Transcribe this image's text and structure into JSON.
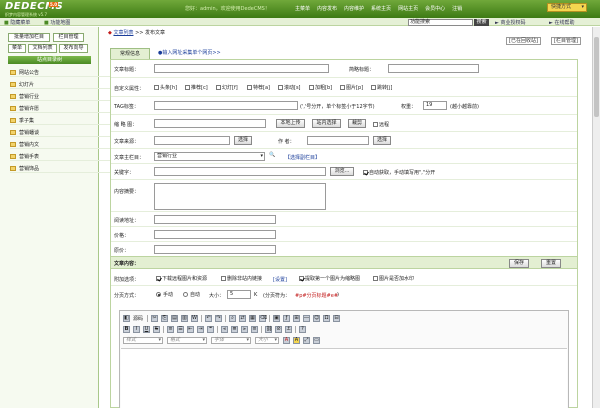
{
  "header": {
    "logo_text": "DEDECMS",
    "logo_sub": "织梦内容管理系统 v5.7",
    "logo_ver": "5.0",
    "user_info": "您好：admin，欢迎使用DedeCMS！",
    "nav": [
      "主菜单",
      "内容发布",
      "内容维护",
      "系统主页",
      "网站主页",
      "会员中心",
      "注销"
    ],
    "quick_label": "快捷方式",
    "sub": {
      "hide_menu": "隐藏菜单",
      "func_map": "功能地图",
      "search_value": "功能搜索",
      "search_button": "搜索",
      "biz_code": "商业授权码",
      "online_help": "在线帮助"
    }
  },
  "left": {
    "buttons": [
      "批量增加栏目",
      "栏目管理",
      "菜单",
      "文档列表",
      "发布向导"
    ],
    "title": "站点目录树",
    "tree": [
      "网站公告",
      "幻灯片",
      "营销行业",
      "营销许愿",
      "季子集",
      "营销蟠谈",
      "营销内文",
      "营销手表",
      "营销饰品"
    ]
  },
  "main": {
    "breadcrumb": {
      "link": "文章列表",
      "sep": ">>",
      "current": "发布文章"
    },
    "toplinks": {
      "recycle": "[已在回收站]",
      "column": "[栏目管理]"
    },
    "tabs": {
      "basic": "常规信息",
      "collect": "●输入网址采集单个网页>>"
    },
    "fields": {
      "title_label": "文章标题：",
      "short_title_label": "简略标题：",
      "custom_attr_label": "自定义属性：",
      "attrs": [
        "头条[h]",
        "推荐[c]",
        "幻灯[f]",
        "特荐[a]",
        "滚动[s]",
        "加粗[b]",
        "图片[p]",
        "跳转[j]"
      ],
      "tag_label": "TAG标签：",
      "tag_note": "(','号分开，单个标签小于12字节)",
      "weight_label": "权重：",
      "weight_value": "19",
      "weight_note": "(越小越靠前)",
      "thumb_label": "缩 略 图：",
      "btn_local": "本地上传",
      "btn_site": "站内选择",
      "btn_crop": "裁剪",
      "remote_label": "远程",
      "source_label": "文章来源：",
      "btn_select": "选择",
      "author_label": "作 者：",
      "column_label": "文章主栏目：",
      "column_value": "营销行业",
      "column_link": "【选择副栏目】",
      "keyword_label": "关键字：",
      "btn_browse": "浏览...",
      "auto_keyword": "自动获取，手动填写用\",\"分开",
      "summary_label": "内容摘要：",
      "wo_label": "阅读地址：",
      "price_label": "价格：",
      "original_price_label": "原价："
    },
    "body_bar": {
      "label": "文章内容：",
      "btn_keep": "保存",
      "btn_reset": "重置"
    },
    "options": {
      "extra_label": "附加选项：",
      "opt1": "下载远程图片和资源",
      "opt2": "删除非站内链接",
      "opt2_link": "[设置]",
      "opt3": "提取第一个图片为缩略图",
      "opt4": "图片是否加水印"
    },
    "paging": {
      "label": "分页方式：",
      "manual": "手动",
      "auto": "自动",
      "size_label": "大小：",
      "size_value": "5",
      "size_unit": "K",
      "note": "(分页符为：",
      "code": "#p#分页标题#e#",
      "note_end": ")"
    },
    "editor": {
      "source_label": "源码",
      "style_placeholder": "样式",
      "format_placeholder": "格式",
      "font_placeholder": "字体",
      "size_placeholder": "大小"
    }
  }
}
